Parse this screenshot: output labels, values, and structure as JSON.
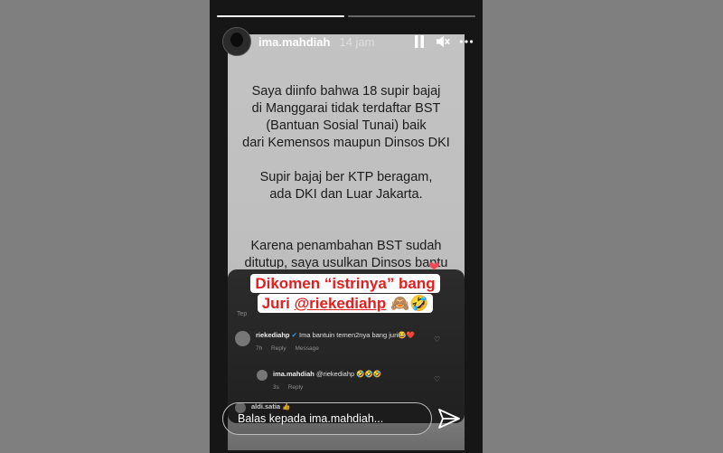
{
  "story": {
    "username": "ima.mahdiah",
    "time": "14 jam",
    "progress": [
      1.0,
      0.0
    ]
  },
  "icons": {
    "pause": "pause-icon",
    "mute": "speaker-muted-icon",
    "more": "more-options-icon",
    "send": "send-icon",
    "heart": "heart-icon"
  },
  "post": {
    "text": "Saya diinfo bahwa 18 supir bajaj\ndi Manggarai tidak terdaftar BST\n(Bantuan Sosial Tunai) baik\ndari Kemensos maupun Dinsos DKI\n\nSupir bajaj ber KTP beragam,\nada DKI dan Luar Jakarta.\n\n\nKarena penambahan BST sudah\nditutup, saya usulkan Dinsos bantu\ndengan Program CSR yaitu sembako"
  },
  "caption": {
    "line1": "Dikomen “istrinya” bang",
    "line2_prefix": "Juri ",
    "mention": "@riekediahp",
    "emoji": "🙈🤣"
  },
  "comments_label": "Tep",
  "comments": [
    {
      "user": "riekediahp",
      "verified": "✔",
      "text": "Ima bantuin temen2nya bang juri😂❤️",
      "age": "7h",
      "reply": "Reply",
      "message": "Message"
    },
    {
      "user": "ima.mahdiah",
      "text": "@riekediahp 🤣🤣🤣",
      "age": "3s",
      "reply": "Reply"
    },
    {
      "user": "aldi.satia",
      "text": "👍"
    }
  ],
  "reply_bar": {
    "placeholder": "Balas kepada ima.mahdiah..."
  },
  "colors": {
    "accent_red": "#e02020",
    "heart": "#ed4956",
    "verified": "#3897f0"
  }
}
